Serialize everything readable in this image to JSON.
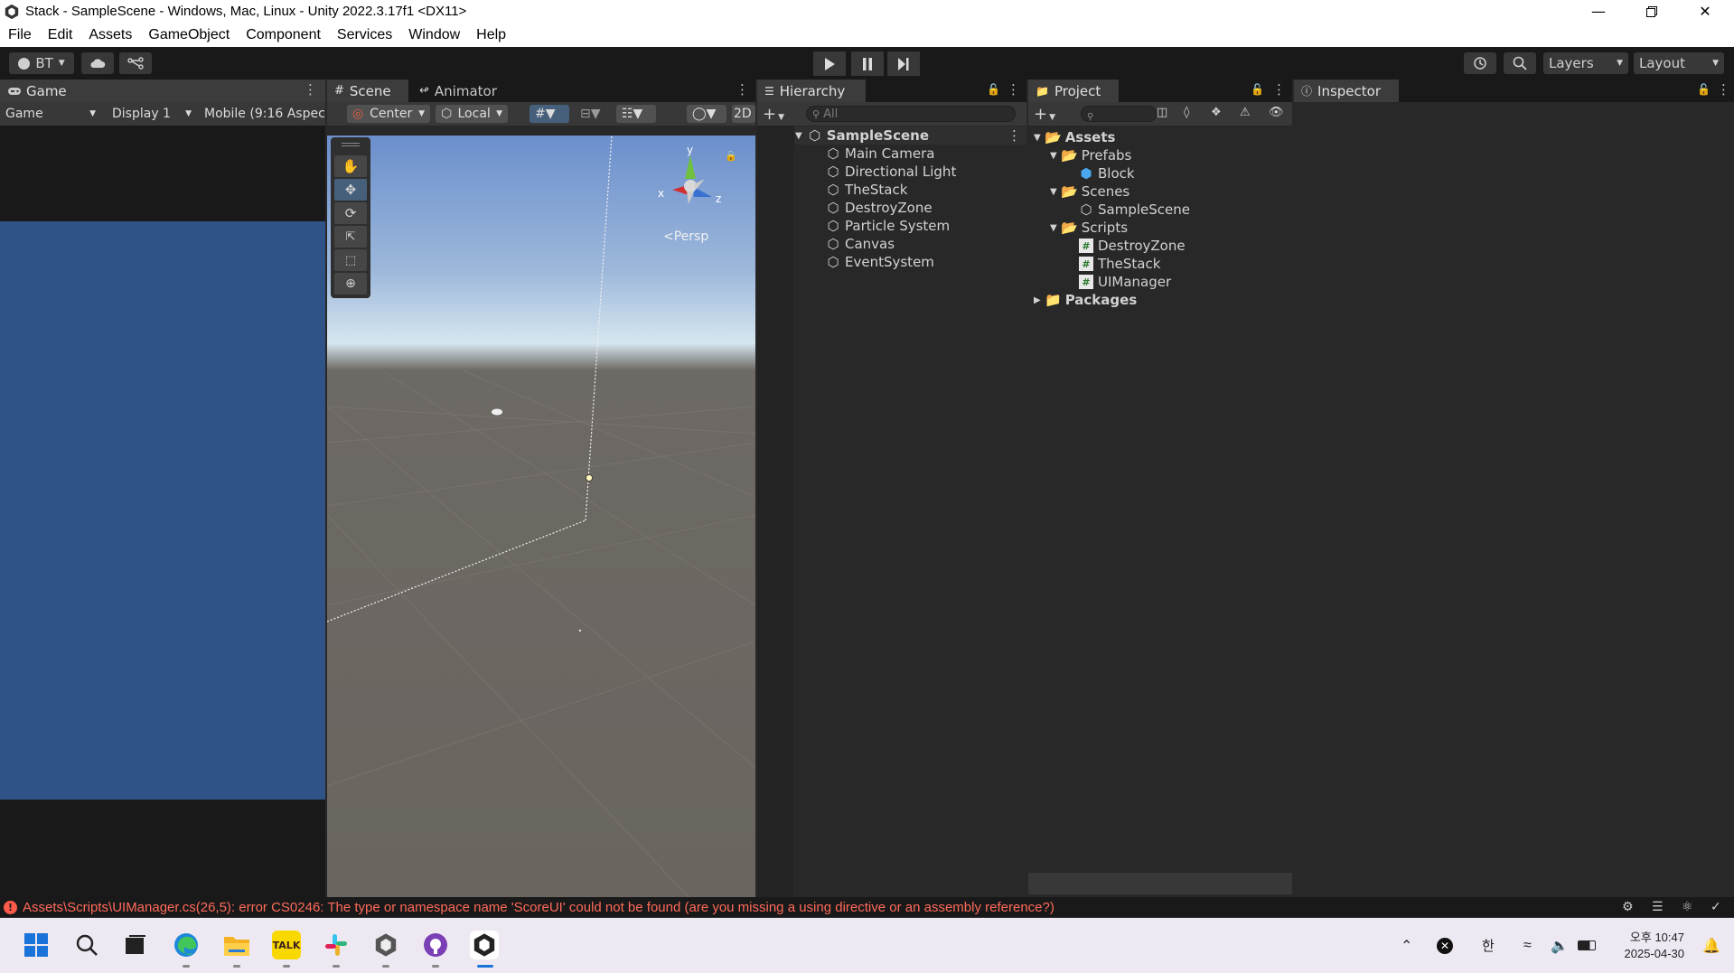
{
  "window": {
    "title": "Stack - SampleScene - Windows, Mac, Linux - Unity 2022.3.17f1 <DX11>",
    "controls": [
      "minimize-icon",
      "restore-icon",
      "close-icon"
    ]
  },
  "menu": [
    "File",
    "Edit",
    "Assets",
    "GameObject",
    "Component",
    "Services",
    "Window",
    "Help"
  ],
  "toolbar": {
    "account_label": "BT",
    "layers_label": "Layers",
    "layout_label": "Layout"
  },
  "game_panel": {
    "tab_label": "Game",
    "view_mode": "Game",
    "display": "Display 1",
    "aspect": "Mobile (9:16 Aspec",
    "viewport_color": "#2f5386"
  },
  "scene_panel": {
    "tabs": [
      "Scene",
      "Animator"
    ],
    "pivot": "Center",
    "space": "Local",
    "mode_2d": "2D",
    "persp_label": "<Persp",
    "gizmo_axes": {
      "y": "y",
      "x": "x",
      "z": "z"
    }
  },
  "hierarchy": {
    "tab_label": "Hierarchy",
    "search_placeholder": "All",
    "scene": "SampleScene",
    "items": [
      "Main Camera",
      "Directional Light",
      "TheStack",
      "DestroyZone",
      "Particle System",
      "Canvas",
      "EventSystem"
    ]
  },
  "project": {
    "tab_label": "Project",
    "tree": {
      "assets": "Assets",
      "prefabs": "Prefabs",
      "block": "Block",
      "scenes": "Scenes",
      "sample_scene": "SampleScene",
      "scripts": "Scripts",
      "destroy_zone": "DestroyZone",
      "the_stack": "TheStack",
      "ui_manager": "UIManager",
      "packages": "Packages"
    }
  },
  "inspector": {
    "tab_label": "Inspector"
  },
  "status": {
    "error": "Assets\\Scripts\\UIManager.cs(26,5): error CS0246: The type or namespace name 'ScoreUI' could not be found (are you missing a using directive or an assembly reference?)"
  },
  "taskbar": {
    "kakao_label": "TALK",
    "ime": "한",
    "time": "오후 10:47",
    "date": "2025-04-30"
  },
  "colors": {
    "error_text": "#ff6a5a",
    "accent_blue": "#2c5d87"
  }
}
